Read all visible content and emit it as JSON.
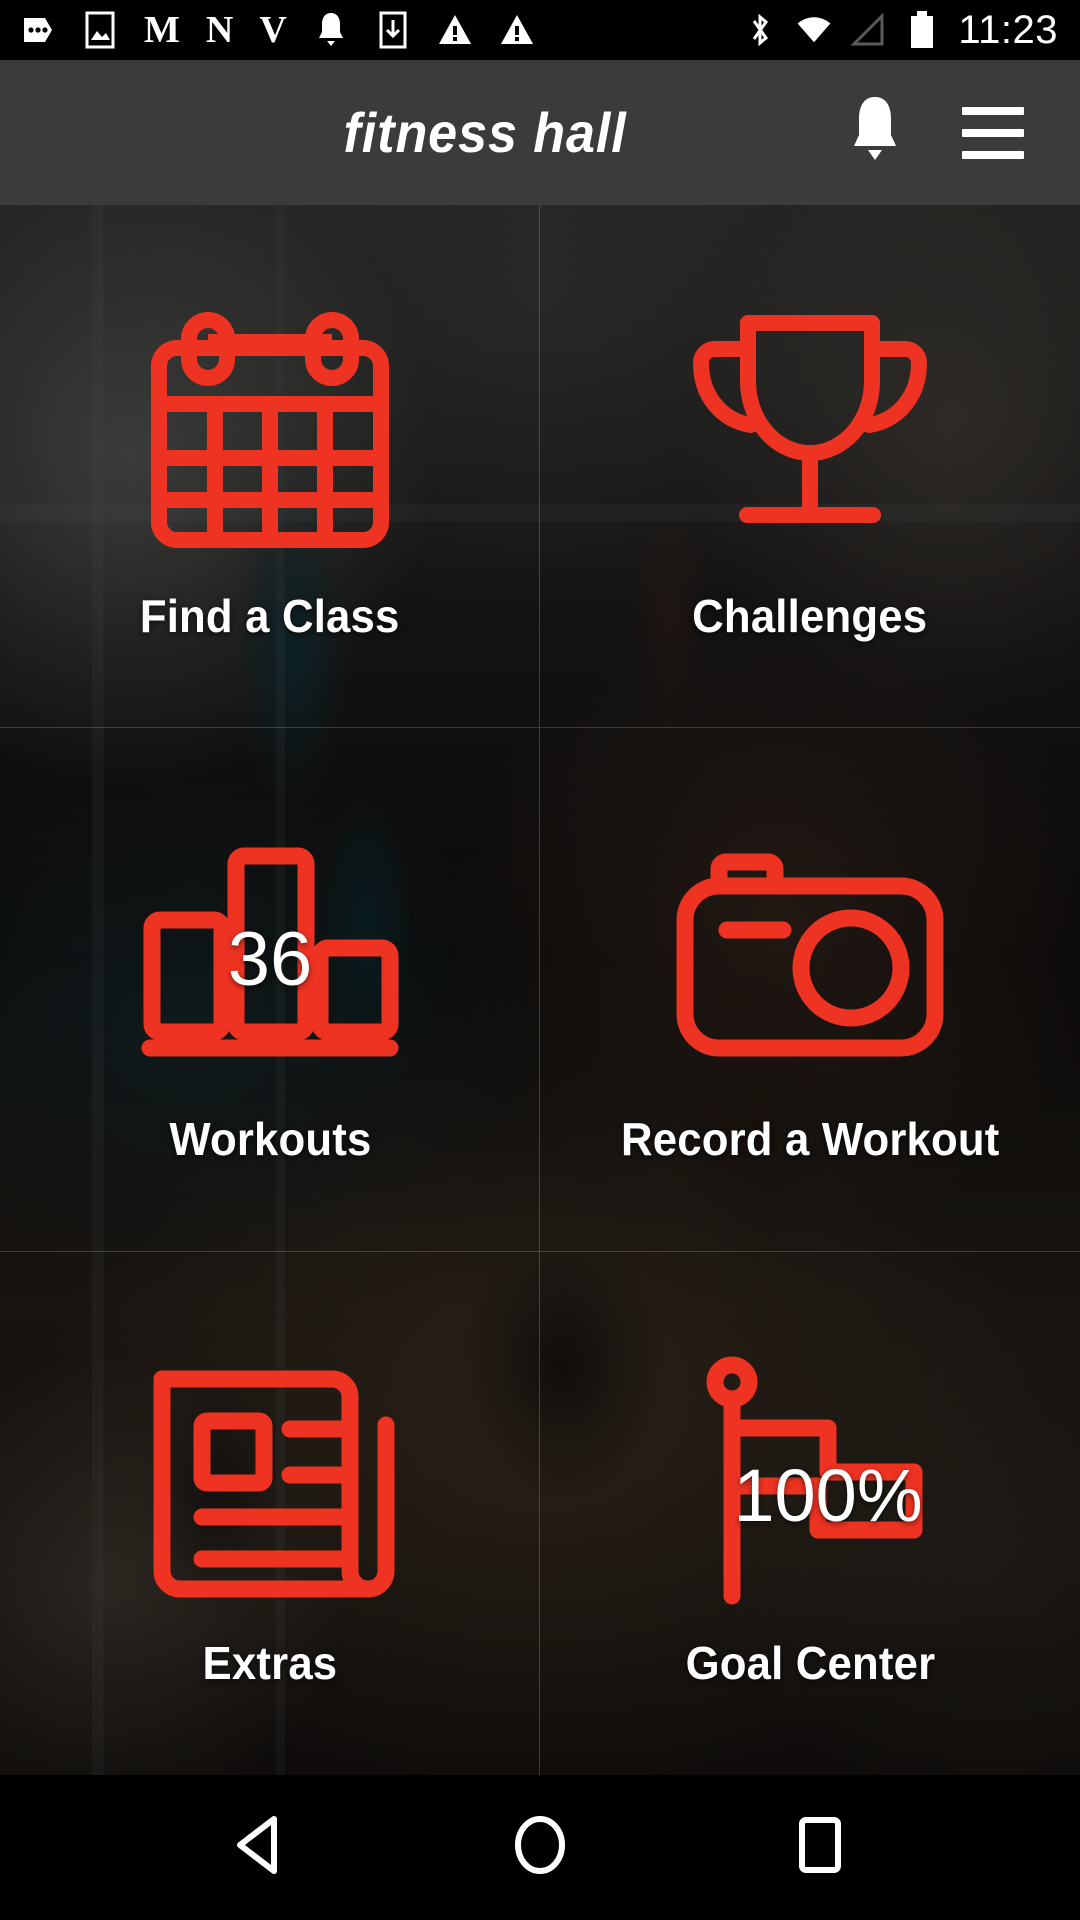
{
  "status_bar": {
    "time": "11:23",
    "left_icons": [
      {
        "name": "more-options-icon",
        "glyph": "dots"
      },
      {
        "name": "screenshot-image-icon",
        "glyph": "image"
      },
      {
        "name": "notification-letter-m-icon",
        "glyph": "M"
      },
      {
        "name": "notification-letter-n-icon",
        "glyph": "N"
      },
      {
        "name": "notification-letter-v-icon",
        "glyph": "V"
      },
      {
        "name": "notification-bell-icon",
        "glyph": "bell"
      },
      {
        "name": "download-icon",
        "glyph": "download"
      },
      {
        "name": "warning-triangle-icon",
        "glyph": "warning"
      },
      {
        "name": "warning-triangle-alt-icon",
        "glyph": "warning"
      }
    ],
    "right_icons": [
      {
        "name": "bluetooth-icon",
        "glyph": "bluetooth"
      },
      {
        "name": "wifi-icon",
        "glyph": "wifi"
      },
      {
        "name": "cellular-signal-icon",
        "glyph": "signal"
      },
      {
        "name": "battery-icon",
        "glyph": "battery"
      }
    ]
  },
  "header": {
    "brand": "fitness hall",
    "notifications_label": "Notifications",
    "menu_label": "Menu"
  },
  "colors": {
    "accent_red": "#EE3322",
    "header_bg": "#3B3B3B",
    "label_text": "#FFFFFF",
    "system_bar": "#000000"
  },
  "tiles": [
    {
      "id": "find-a-class",
      "label": "Find a Class",
      "icon": "calendar-icon",
      "value": ""
    },
    {
      "id": "challenges",
      "label": "Challenges",
      "icon": "trophy-icon",
      "value": ""
    },
    {
      "id": "workouts",
      "label": "Workouts",
      "icon": "bar-chart-icon",
      "value": "36"
    },
    {
      "id": "record-a-workout",
      "label": "Record a Workout",
      "icon": "camera-icon",
      "value": ""
    },
    {
      "id": "extras",
      "label": "Extras",
      "icon": "article-icon",
      "value": ""
    },
    {
      "id": "goal-center",
      "label": "Goal Center",
      "icon": "flag-icon",
      "value": "100%"
    }
  ],
  "nav_bar": {
    "back_label": "Back",
    "home_label": "Home",
    "recents_label": "Recent apps"
  }
}
